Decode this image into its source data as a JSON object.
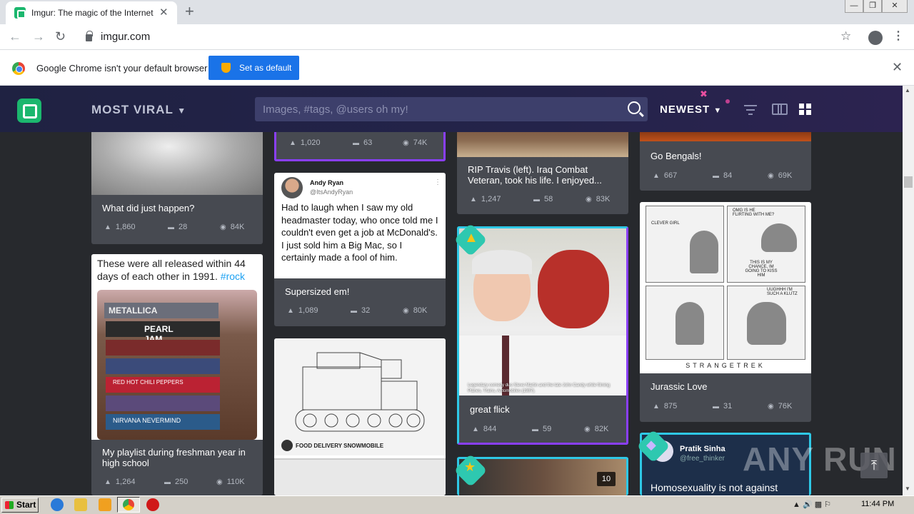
{
  "browser": {
    "tab_title": "Imgur: The magic of the Internet",
    "tab_close": "✕",
    "new_tab": "+",
    "url": "imgur.com",
    "infobar_text": "Google Chrome isn't your default browser",
    "set_default_label": "Set as default",
    "infobar_close": "✕"
  },
  "imgur": {
    "section_label": "MOST VIRAL",
    "search_placeholder": "Images, #tags, @users oh my!",
    "sort_label": "NEWEST"
  },
  "posts": {
    "p1": {
      "title": "What did just happen?",
      "up": "1,860",
      "comments": "28",
      "views": "84K"
    },
    "p2": {
      "caption": "These were all released within 44 days of each other in 1991.",
      "tag": "#rock",
      "title": "My playlist during freshman year in high school",
      "up": "1,264",
      "comments": "250",
      "views": "110K"
    },
    "p3": {
      "up": "1,020",
      "comments": "63",
      "views": "74K"
    },
    "p4": {
      "author": "Andy Ryan",
      "handle": "@ItsAndyRyan",
      "tweet": "Had to laugh when I saw my old headmaster today, who once told me I couldn't even get a job at McDonald's. I just sold him a Big Mac, so I certainly made a fool of him.",
      "title": "Supersized em!",
      "up": "1,089",
      "comments": "32",
      "views": "80K"
    },
    "p5": {
      "sketch_label": "FOOD DELIVERY SNOWMOBILE"
    },
    "p6": {
      "title": "RIP Travis (left). Iraq Combat Veteran, took his life. I enjoyed...",
      "up": "1,247",
      "comments": "58",
      "views": "83K"
    },
    "p7": {
      "caption": "Legendary comedy duo Steve Martin and the late John Candy while filming Planes, Trains, Automobiles (1987).",
      "title": "great flick",
      "up": "844",
      "comments": "59",
      "views": "82K"
    },
    "p8": {
      "badge_count": "10"
    },
    "p9": {
      "title": "Go Bengals!",
      "up": "667",
      "comments": "84",
      "views": "69K"
    },
    "p10": {
      "panel1": "CLEVER GIRL",
      "panel2": "OMG IS HE FLIRTING WITH ME?",
      "panel2b": "THIS IS MY CHANCE, IM GOING TO KISS HIM",
      "panel4": "UUGHHH I'M SUCH A KLUTZ",
      "footer": "STRANGETREK",
      "title": "Jurassic Love",
      "up": "875",
      "comments": "31",
      "views": "76K"
    },
    "p11": {
      "author": "Pratik Sinha",
      "handle": "@free_thinker",
      "tweet": "Homosexuality is not against"
    }
  },
  "watermark": "ANY RUN",
  "taskbar": {
    "start": "Start",
    "clock": "11:44 PM"
  },
  "colors": {
    "imgur_green": "#1bb76e",
    "card_bg": "#474a51",
    "page_bg": "#27292d",
    "header_bg": "#1f2242",
    "promoted_purple": "#8a3ffc",
    "promoted_cyan": "#2ec8e6"
  }
}
